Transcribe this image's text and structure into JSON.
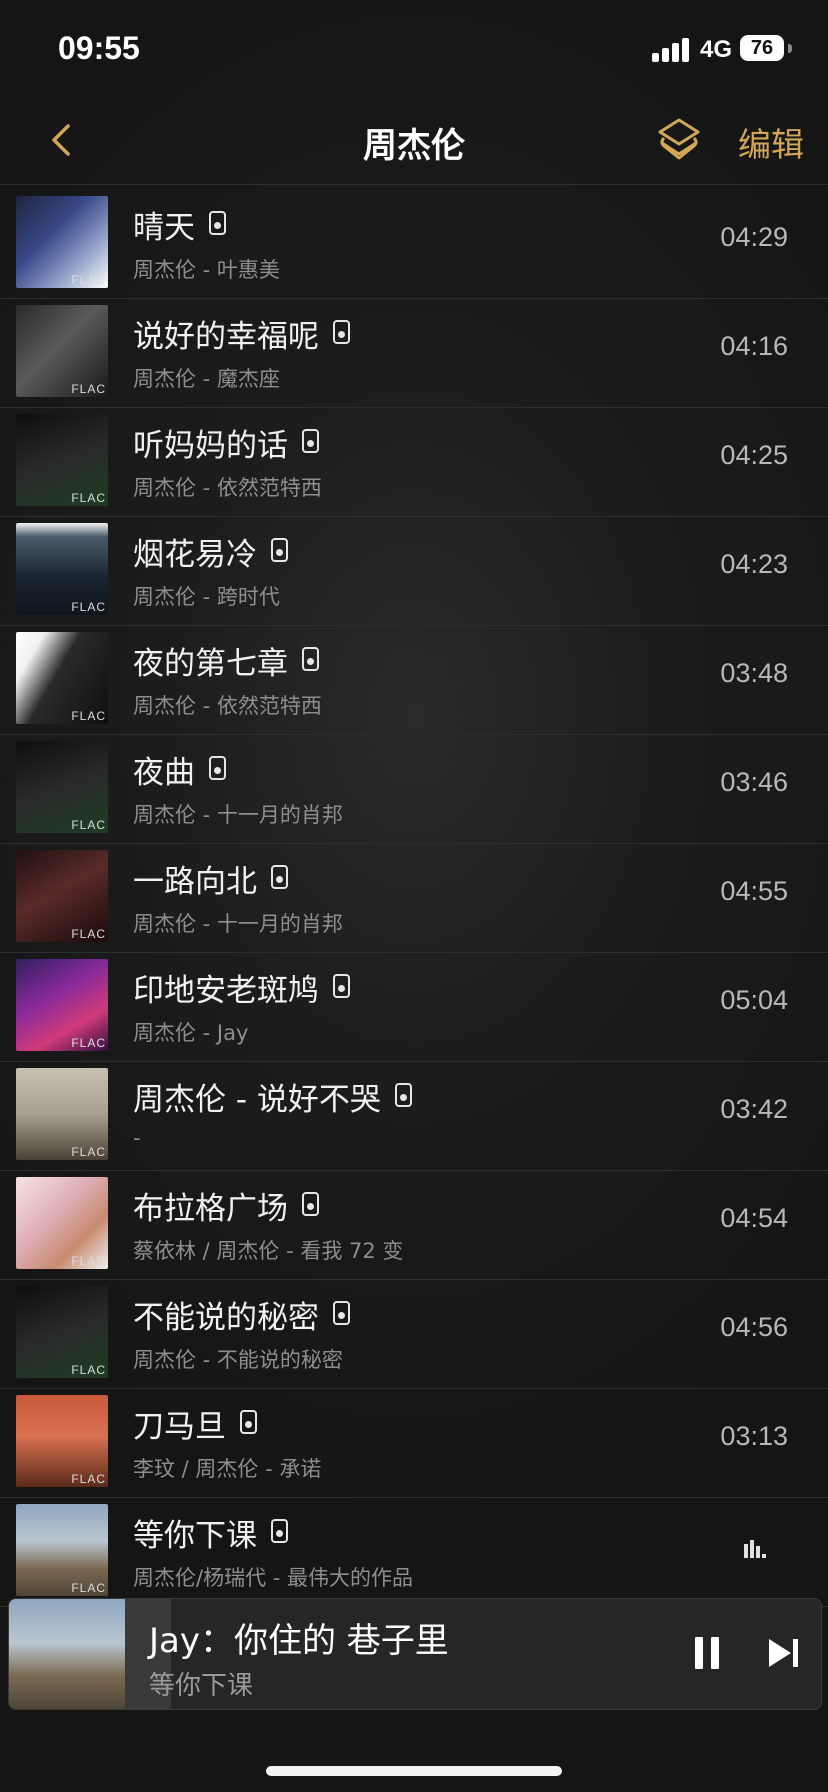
{
  "status": {
    "time": "09:55",
    "network": "4G",
    "battery": "76"
  },
  "nav": {
    "title": "周杰伦",
    "edit_label": "编辑"
  },
  "cover_badge": "FLAC",
  "songs": [
    {
      "title": "晴天",
      "subtitle": "周杰伦 - 叶惠美",
      "duration": "04:29"
    },
    {
      "title": "说好的幸福呢",
      "subtitle": "周杰伦 - 魔杰座",
      "duration": "04:16"
    },
    {
      "title": "听妈妈的话",
      "subtitle": "周杰伦 - 依然范特西",
      "duration": "04:25"
    },
    {
      "title": "烟花易冷",
      "subtitle": "周杰伦 - 跨时代",
      "duration": "04:23"
    },
    {
      "title": "夜的第七章",
      "subtitle": "周杰伦 - 依然范特西",
      "duration": "03:48"
    },
    {
      "title": "夜曲",
      "subtitle": "周杰伦 - 十一月的肖邦",
      "duration": "03:46"
    },
    {
      "title": "一路向北",
      "subtitle": "周杰伦 - 十一月的肖邦",
      "duration": "04:55"
    },
    {
      "title": "印地安老斑鸠",
      "subtitle": "周杰伦 - Jay",
      "duration": "05:04"
    },
    {
      "title": "周杰伦 - 说好不哭",
      "subtitle": " -",
      "duration": "03:42"
    },
    {
      "title": "布拉格广场",
      "subtitle": "蔡依林 / 周杰伦 - 看我 72 变",
      "duration": "04:54"
    },
    {
      "title": "不能说的秘密",
      "subtitle": "周杰伦 - 不能说的秘密",
      "duration": "04:56"
    },
    {
      "title": "刀马旦",
      "subtitle": "李玟 / 周杰伦 - 承诺",
      "duration": "03:13"
    },
    {
      "title": "等你下课",
      "subtitle": "周杰伦/杨瑞代 - 最伟大的作品",
      "duration": ""
    }
  ],
  "now_playing": {
    "title": "Jay：你住的 巷子里",
    "subtitle": "等你下课"
  },
  "colors": {
    "accent": "#d2a656",
    "background": "#1c1c1c",
    "divider": "#2e2e2e"
  }
}
